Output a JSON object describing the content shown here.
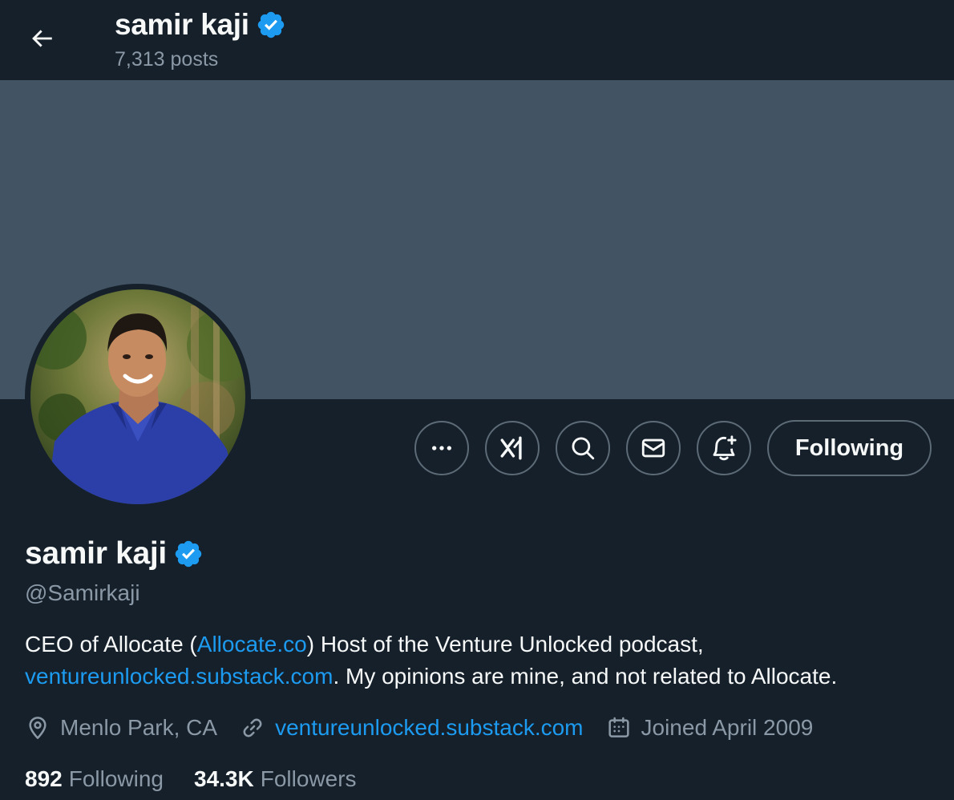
{
  "header": {
    "name": "samir kaji",
    "posts": "7,313 posts"
  },
  "actions": {
    "more": "more-icon",
    "grok": "grok-icon",
    "search": "search-icon",
    "message": "mail-icon",
    "notify": "bell-plus-icon",
    "following_label": "Following"
  },
  "profile": {
    "display_name": "samir kaji",
    "handle": "@Samirkaji",
    "bio": {
      "part1": "CEO of Allocate (",
      "link1": "Allocate.co",
      "part2": ")  Host of the Venture Unlocked podcast,",
      "link2": "ventureunlocked.substack.com",
      "part3": ". My opinions are mine, and not related to Allocate."
    },
    "location": "Menlo Park, CA",
    "website": "ventureunlocked.substack.com",
    "joined": "Joined April 2009",
    "following_count": "892",
    "following_label": "Following",
    "followers_count": "34.3K",
    "followers_label": "Followers"
  },
  "colors": {
    "background": "#15202b",
    "banner": "#425463",
    "accent": "#1d9bf0",
    "muted": "#8b98a5"
  }
}
